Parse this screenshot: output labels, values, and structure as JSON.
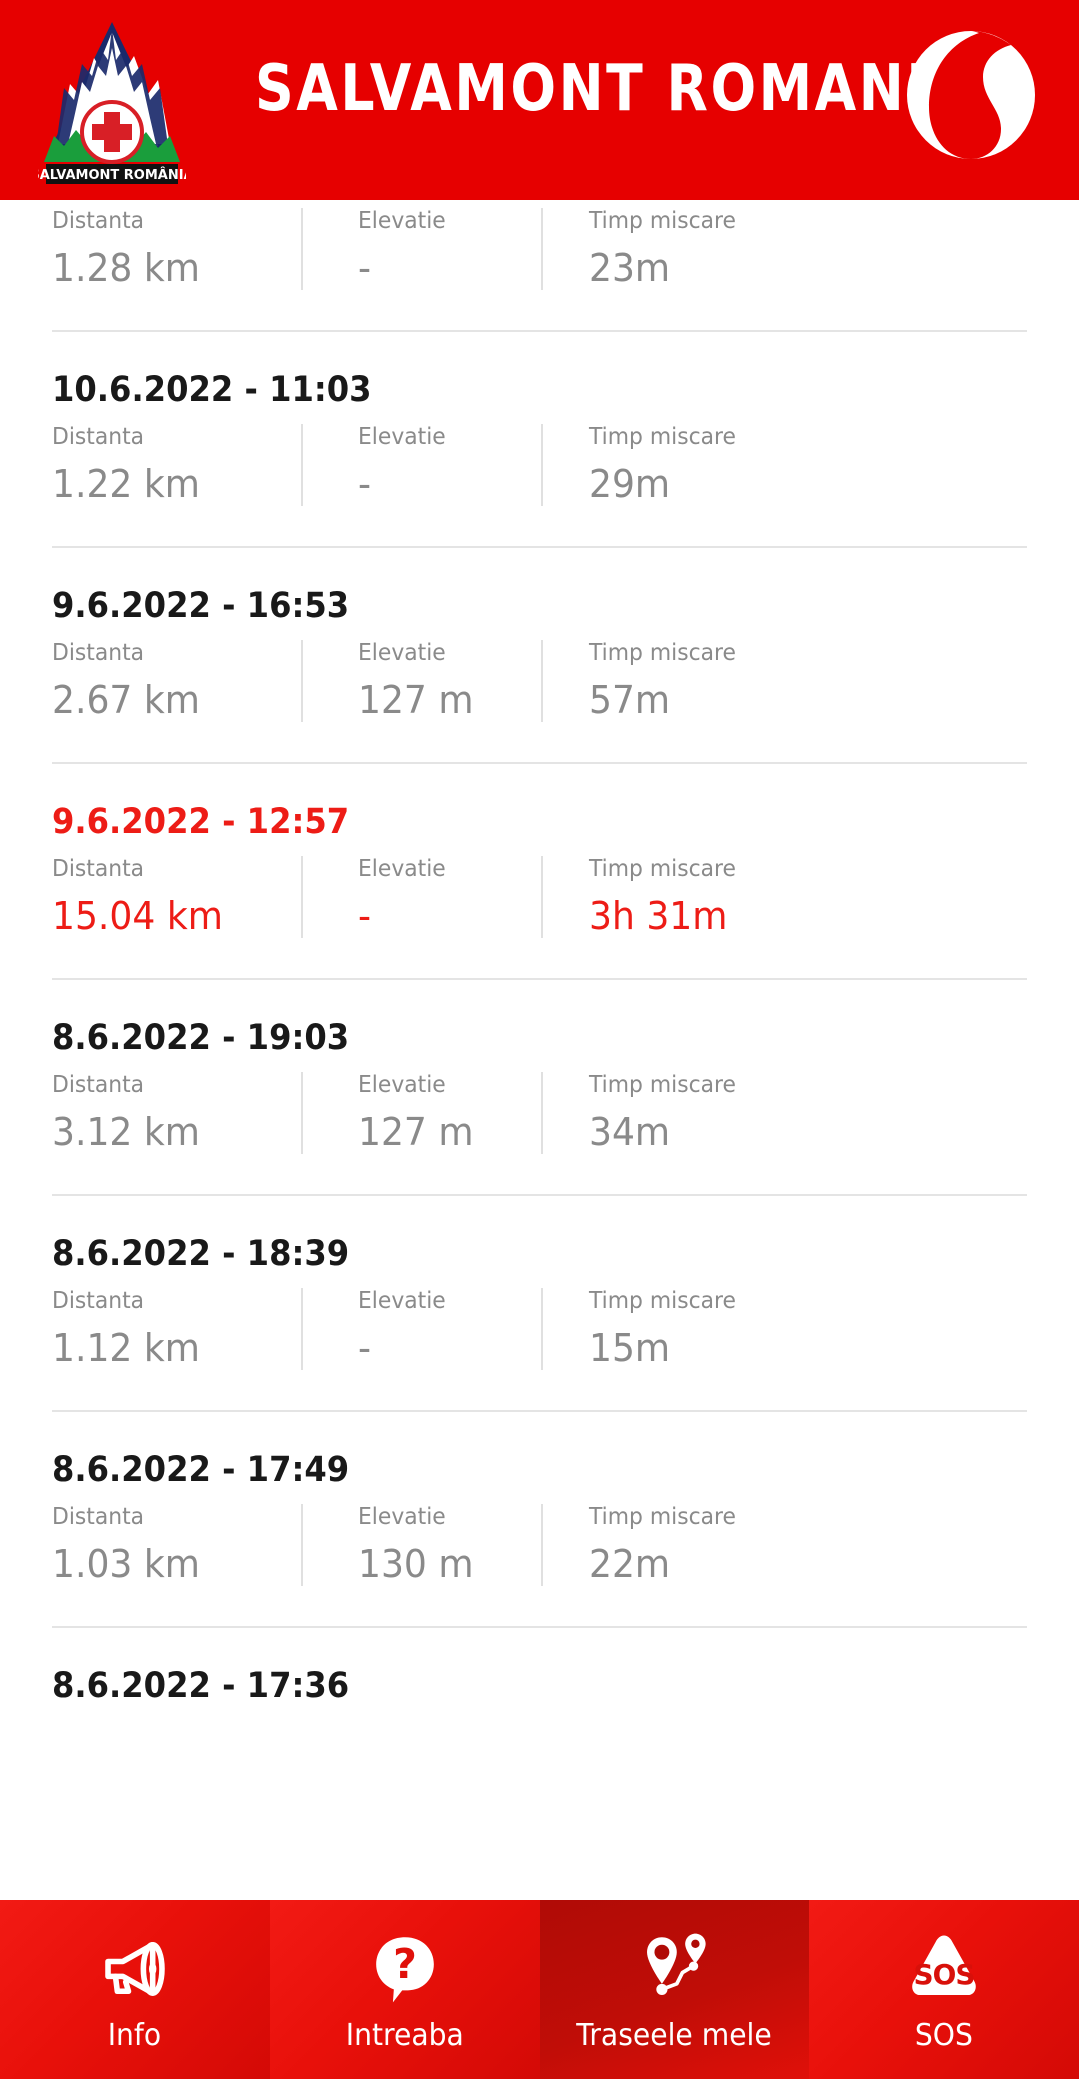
{
  "header": {
    "brand_title": "SALVAMONT ROMANIA",
    "logo_caption": "SALVAMONT ROMÂNIA",
    "logo_icon": "mountain-red-cross-icon",
    "carrier_logo_icon": "vodafone-speechmark-icon",
    "background_color": "#E60000"
  },
  "labels": {
    "distance": "Distanta",
    "elevation": "Elevatie",
    "moving_time": "Timp miscare"
  },
  "colors": {
    "brand_red": "#E60000",
    "highlight_red": "#ED1C16",
    "value_grey": "#8a8a8a",
    "date_black": "#191919",
    "divider": "#e4e4e4"
  },
  "tracks": [
    {
      "date": "",
      "distance": "1.28 km",
      "elevation": "-",
      "moving_time": "23m",
      "highlighted": false,
      "partial_top": true
    },
    {
      "date": "10.6.2022 - 11:03",
      "distance": "1.22 km",
      "elevation": "-",
      "moving_time": "29m",
      "highlighted": false,
      "partial_top": false
    },
    {
      "date": "9.6.2022 - 16:53",
      "distance": "2.67 km",
      "elevation": "127 m",
      "moving_time": "57m",
      "highlighted": false,
      "partial_top": false
    },
    {
      "date": "9.6.2022 - 12:57",
      "distance": "15.04 km",
      "elevation": "-",
      "moving_time": "3h 31m",
      "highlighted": true,
      "partial_top": false
    },
    {
      "date": "8.6.2022 - 19:03",
      "distance": "3.12 km",
      "elevation": "127 m",
      "moving_time": "34m",
      "highlighted": false,
      "partial_top": false
    },
    {
      "date": "8.6.2022 - 18:39",
      "distance": "1.12 km",
      "elevation": "-",
      "moving_time": "15m",
      "highlighted": false,
      "partial_top": false
    },
    {
      "date": "8.6.2022 - 17:49",
      "distance": "1.03 km",
      "elevation": "130 m",
      "moving_time": "22m",
      "highlighted": false,
      "partial_top": false
    },
    {
      "date": "8.6.2022 - 17:36",
      "distance": "",
      "elevation": "",
      "moving_time": "",
      "highlighted": false,
      "partial_top": false
    }
  ],
  "bottom_nav": {
    "tabs": [
      {
        "label": "Info",
        "icon": "megaphone-icon",
        "active": false
      },
      {
        "label": "Intreaba",
        "icon": "question-speech-bubble-icon",
        "active": false
      },
      {
        "label": "Traseele mele",
        "icon": "route-pins-icon",
        "active": true
      },
      {
        "label": "SOS",
        "icon": "sos-triangle-icon",
        "active": false
      }
    ],
    "sos_text": "SOS"
  }
}
